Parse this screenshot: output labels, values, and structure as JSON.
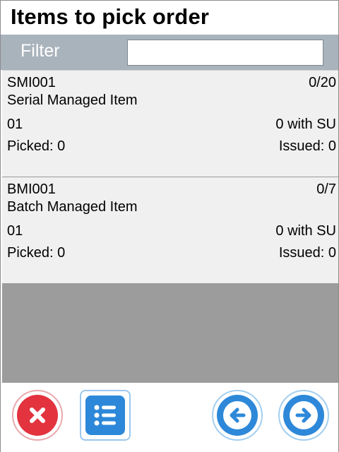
{
  "header": {
    "title": "Items to pick order"
  },
  "filter": {
    "label": "Filter",
    "value": "",
    "placeholder": ""
  },
  "items": [
    {
      "code": "SMI001",
      "quantity": "0/20",
      "description": "Serial Managed Item",
      "location": "01",
      "su": "0 with SU",
      "picked": "Picked: 0",
      "issued": "Issued: 0"
    },
    {
      "code": "BMI001",
      "quantity": "0/7",
      "description": "Batch Managed Item",
      "location": "01",
      "su": "0 with SU",
      "picked": "Picked: 0",
      "issued": "Issued: 0"
    }
  ],
  "toolbar": {
    "cancel_icon": "close-icon",
    "list_icon": "list-icon",
    "back_icon": "arrow-left-icon",
    "next_icon": "arrow-right-icon"
  },
  "colors": {
    "filter_bar": "#a9b3bc",
    "cancel": "#e3333f",
    "accent": "#2d88d9",
    "list_background": "#9c9c9c"
  }
}
